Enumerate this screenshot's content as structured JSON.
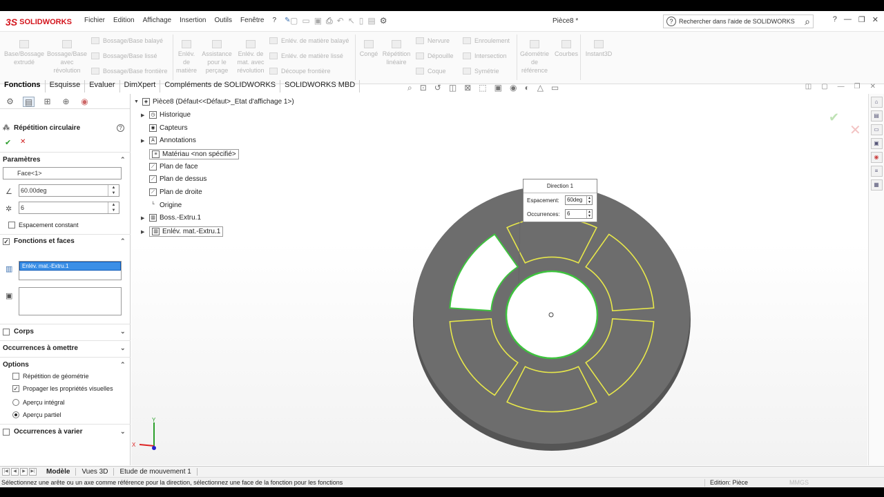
{
  "app": {
    "brand": "SOLIDWORKS",
    "document_title": "Pièce8 *",
    "menu": [
      "Fichier",
      "Edition",
      "Affichage",
      "Insertion",
      "Outils",
      "Fenêtre",
      "?"
    ],
    "search_placeholder": "Rechercher dans l'aide de SOLIDWORKS",
    "help_label": "?"
  },
  "ribbon": {
    "big_buttons": [
      {
        "label": "Base/Bossage extrudé"
      },
      {
        "label": "Bossage/Base avec révolution"
      },
      {
        "label": "Enlév. de matière"
      },
      {
        "label": "Assistance pour le perçage"
      },
      {
        "label": "Enlév. de mat. avec révolution"
      },
      {
        "label": "Congé"
      },
      {
        "label": "Répétition linéaire"
      },
      {
        "label": "Géométrie de référence"
      },
      {
        "label": "Courbes"
      },
      {
        "label": "Instant3D"
      }
    ],
    "small_buttons": [
      "Bossage/Base balayé",
      "Bossage/Base lissé",
      "Bossage/Base frontière",
      "Enlév. de matière balayé",
      "Enlév. de matière lissé",
      "Découpe frontière",
      "Nervure",
      "Dépouille",
      "Coque",
      "Enroulement",
      "Intersection",
      "Symétrie"
    ]
  },
  "command_tabs": [
    "Fonctions",
    "Esquisse",
    "Evaluer",
    "DimXpert",
    "Compléments de SOLIDWORKS",
    "SOLIDWORKS MBD"
  ],
  "property_manager": {
    "title": "Répétition circulaire",
    "help_icon": "?",
    "ok_icon": "✔",
    "cancel_icon": "✕",
    "parametres": {
      "header": "Paramètres",
      "direction_face": "Face<1>",
      "angle": "60.00deg",
      "count": "6",
      "equal_spacing_label": "Espacement constant",
      "equal_spacing_checked": false
    },
    "features": {
      "header": "Fonctions et faces",
      "checked": true,
      "selected_feature": "Enlév. mat.-Extru.1"
    },
    "bodies": {
      "header": "Corps",
      "checked": false
    },
    "skip": {
      "header": "Occurrences à omettre"
    },
    "options": {
      "header": "Options",
      "geometry_pattern": {
        "label": "Répétition de géométrie",
        "checked": false
      },
      "propagate": {
        "label": "Propager les propriétés visuelles",
        "checked": true
      },
      "full_preview": {
        "label": "Aperçu intégral",
        "selected": false
      },
      "partial_preview": {
        "label": "Aperçu partiel",
        "selected": true
      }
    },
    "vary": {
      "header": "Occurrences à varier",
      "checked": false
    }
  },
  "feature_tree": {
    "root": "Pièce8  (Défaut<<Défaut>_Etat d'affichage 1>)",
    "items": [
      {
        "label": "Historique",
        "expand": true
      },
      {
        "label": "Capteurs",
        "expand": false
      },
      {
        "label": "Annotations",
        "expand": true
      },
      {
        "label": "Matériau <non spécifié>",
        "expand": false
      },
      {
        "label": "Plan de face",
        "expand": false
      },
      {
        "label": "Plan de dessus",
        "expand": false
      },
      {
        "label": "Plan de droite",
        "expand": false
      },
      {
        "label": "Origine",
        "expand": false
      },
      {
        "label": "Boss.-Extru.1",
        "expand": true
      },
      {
        "label": "Enlév. mat.-Extru.1",
        "expand": true
      }
    ]
  },
  "callout": {
    "title": "Direction 1",
    "spacing_label": "Espacement:",
    "spacing_value": "60deg",
    "count_label": "Occurrences:",
    "count_value": "6"
  },
  "triad": {
    "x": "X",
    "y": "Y"
  },
  "bottom_tabs": [
    "Modèle",
    "Vues 3D",
    "Etude de mouvement 1"
  ],
  "status": {
    "message": "Sélectionnez une arête ou un axe comme référence pour la direction, sélectionnez une face de la fonction pour les fonctions",
    "edition": "Edition: Pièce",
    "units": "MMGS"
  },
  "colors": {
    "brand_red": "#d3141c",
    "part_gray": "#6d6d6d",
    "pattern_yellow": "#e8e84a",
    "selected_green": "#3ec33e",
    "selection_blue": "#3b8fe6"
  }
}
